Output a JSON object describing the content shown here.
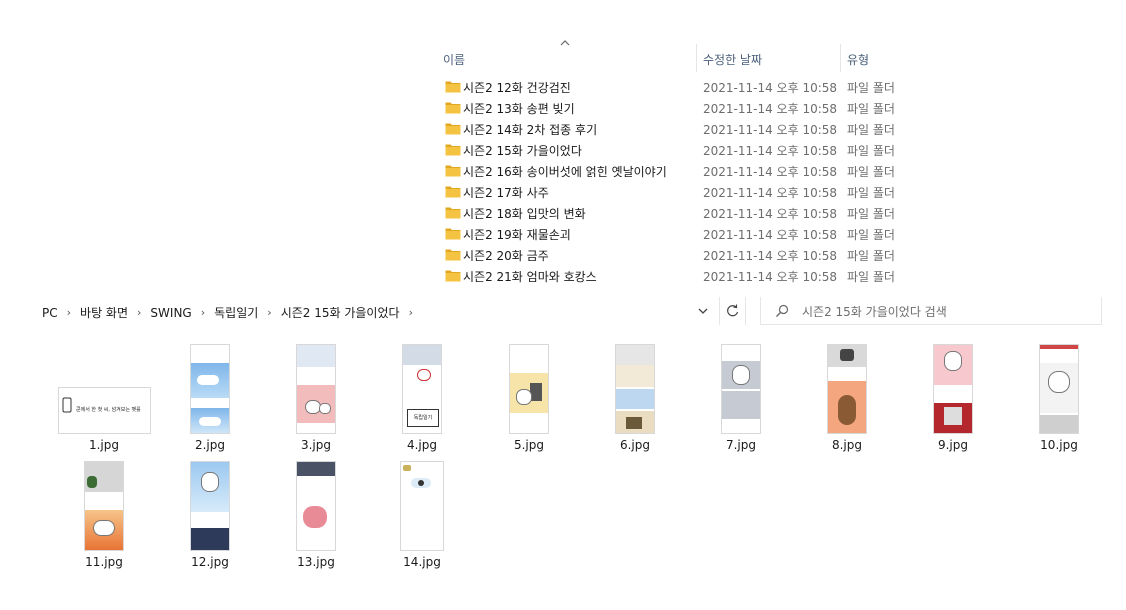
{
  "list": {
    "columns": {
      "name": "이름",
      "date": "수정한 날짜",
      "type": "유형"
    },
    "rows": [
      {
        "name": "시즌2 12화 건강검진",
        "date": "2021-11-14 오후 10:58",
        "type": "파일 폴더"
      },
      {
        "name": "시즌2 13화 송편 빚기",
        "date": "2021-11-14 오후 10:58",
        "type": "파일 폴더"
      },
      {
        "name": "시즌2 14화 2차 접종 후기",
        "date": "2021-11-14 오후 10:58",
        "type": "파일 폴더"
      },
      {
        "name": "시즌2 15화 가을이었다",
        "date": "2021-11-14 오후 10:58",
        "type": "파일 폴더"
      },
      {
        "name": "시즌2 16화  송이버섯에 얽힌 옛날이야기",
        "date": "2021-11-14 오후 10:58",
        "type": "파일 폴더"
      },
      {
        "name": "시즌2 17화 사주",
        "date": "2021-11-14 오후 10:58",
        "type": "파일 폴더"
      },
      {
        "name": "시즌2 18화 입맛의 변화",
        "date": "2021-11-14 오후 10:58",
        "type": "파일 폴더"
      },
      {
        "name": "시즌2 19화 재물손괴",
        "date": "2021-11-14 오후 10:58",
        "type": "파일 폴더"
      },
      {
        "name": "시즌2 20화 금주",
        "date": "2021-11-14 오후 10:58",
        "type": "파일 폴더"
      },
      {
        "name": "시즌2 21화 엄마와 호캉스",
        "date": "2021-11-14 오후 10:58",
        "type": "파일 폴더"
      }
    ]
  },
  "address": {
    "crumbs": [
      "PC",
      "바탕 화면",
      "SWING",
      "독립일기",
      "시즌2 15화 가을이었다"
    ]
  },
  "search": {
    "placeholder": "시즌2 15화 가을이었다 검색"
  },
  "thumb_text": {
    "t1": "쿤에서 한 첫 씨, 넘겨보는 팻를",
    "t4": "독립일기"
  },
  "files": [
    {
      "name": "1.jpg"
    },
    {
      "name": "2.jpg"
    },
    {
      "name": "3.jpg"
    },
    {
      "name": "4.jpg"
    },
    {
      "name": "5.jpg"
    },
    {
      "name": "6.jpg"
    },
    {
      "name": "7.jpg"
    },
    {
      "name": "8.jpg"
    },
    {
      "name": "9.jpg"
    },
    {
      "name": "10.jpg"
    },
    {
      "name": "11.jpg"
    },
    {
      "name": "12.jpg"
    },
    {
      "name": "13.jpg"
    },
    {
      "name": "14.jpg"
    }
  ],
  "colors": {
    "folder": "#f5c342",
    "folder_dark": "#e0a820",
    "header_text": "#4c607a"
  }
}
